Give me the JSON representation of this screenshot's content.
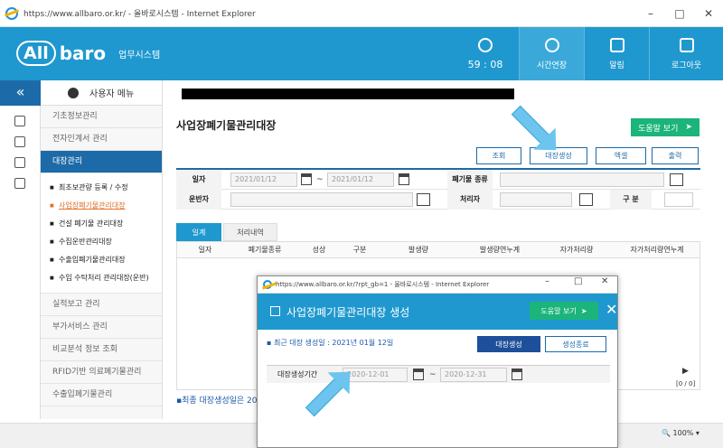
{
  "browser": {
    "title": "https://www.allbaro.or.kr/ - 올바로시스템 - Internet Explorer",
    "zoom": "100%"
  },
  "header": {
    "brand_mark": "All",
    "brand_word": "baro",
    "brand_sub": "업무시스템",
    "timer": "59 : 08",
    "extend_label": "시간연장",
    "alarm_label": "알림",
    "logout_label": "로그아웃"
  },
  "sidebar": {
    "head": "사용자 메뉴",
    "items_top": [
      "기초정보관리",
      "전자인계서 관리"
    ],
    "active": "대장관리",
    "subitems": [
      "최초보관량 등록 / 수정",
      "사업장폐기물관리대장",
      "건설 폐기물 관리대장",
      "수집운반관리대장",
      "수출입폐기물관리대장",
      "수입 수탁처리 관리대장(운반)"
    ],
    "items_bottom": [
      "실적보고 관리",
      "부가서비스 관리",
      "비교분석 정보 조회",
      "RFID기반 의료폐기물관리",
      "수출입폐기물관리"
    ]
  },
  "main": {
    "title": "사업장폐기물관리대장",
    "help": "도움말 보기",
    "actions": [
      "조회",
      "대장생성",
      "엑셀",
      "출력"
    ],
    "form": {
      "date_label": "일자",
      "date_from": "2021/01/12",
      "date_to": "2021/01/12",
      "waste_type_label": "폐기물 종류",
      "carrier_label": "운반자",
      "processor_label": "처리자",
      "category_label": "구 분"
    },
    "tabs": [
      "일계",
      "처리내역"
    ],
    "columns": [
      "일자",
      "폐기물종류",
      "성상",
      "구분",
      "발생량",
      "발생량연누계",
      "자가처리량",
      "자가처리량연누계"
    ],
    "count": "[0 / 0]",
    "notice": "▪최종 대장생성일은 202"
  },
  "popup": {
    "title": "https://www.allbaro.or.kr/?rpt_gb=1 - 올바로시스템 - Internet Explorer",
    "heading": "사업장폐기물관리대장 생성",
    "help": "도움말 보기",
    "recent": "▪ 최근 대장 생성일 : 2021년 01월 12일",
    "create_btn": "대장생성",
    "close_btn": "생성종료",
    "period_label": "대장생성기간",
    "period_from": "2020-12-01",
    "period_to": "2020-12-31"
  }
}
